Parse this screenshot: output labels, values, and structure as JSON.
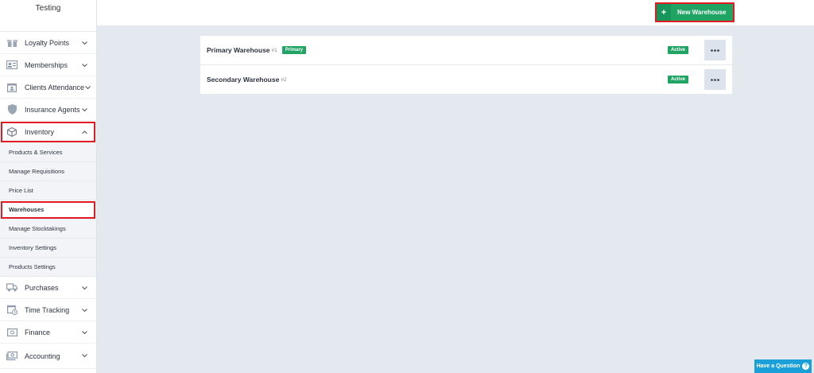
{
  "brand": "Testing",
  "sidebar": {
    "top_items": [
      {
        "label": "Loyalty Points",
        "icon": "gift-icon"
      },
      {
        "label": "Memberships",
        "icon": "id-card-icon"
      },
      {
        "label": "Clients Attendance",
        "icon": "calendar-user-icon"
      },
      {
        "label": "Insurance Agents",
        "icon": "shield-icon"
      },
      {
        "label": "Inventory",
        "icon": "box-icon"
      }
    ],
    "sub_items": [
      "Products & Services",
      "Manage Requisitions",
      "Price List",
      "Warehouses",
      "Manage Stocktakings",
      "Inventory Settings",
      "Products Settings"
    ],
    "bottom_items": [
      {
        "label": "Purchases",
        "icon": "truck-icon"
      },
      {
        "label": "Time Tracking",
        "icon": "clock-calendar-icon"
      },
      {
        "label": "Finance",
        "icon": "money-icon"
      },
      {
        "label": "Accounting",
        "icon": "cash-icon"
      }
    ]
  },
  "header": {
    "new_button_label": "New Warehouse",
    "plus": "+"
  },
  "warehouses": [
    {
      "name": "Primary Warehouse",
      "number": "#1",
      "badge": "Primary",
      "status": "Active"
    },
    {
      "name": "Secondary Warehouse",
      "number": "#2",
      "status": "Active"
    }
  ],
  "help_label": "Have a Question",
  "colors": {
    "accent_green": "#1fa463",
    "highlight_red": "#e01b24",
    "help_blue": "#1a9fd8"
  }
}
